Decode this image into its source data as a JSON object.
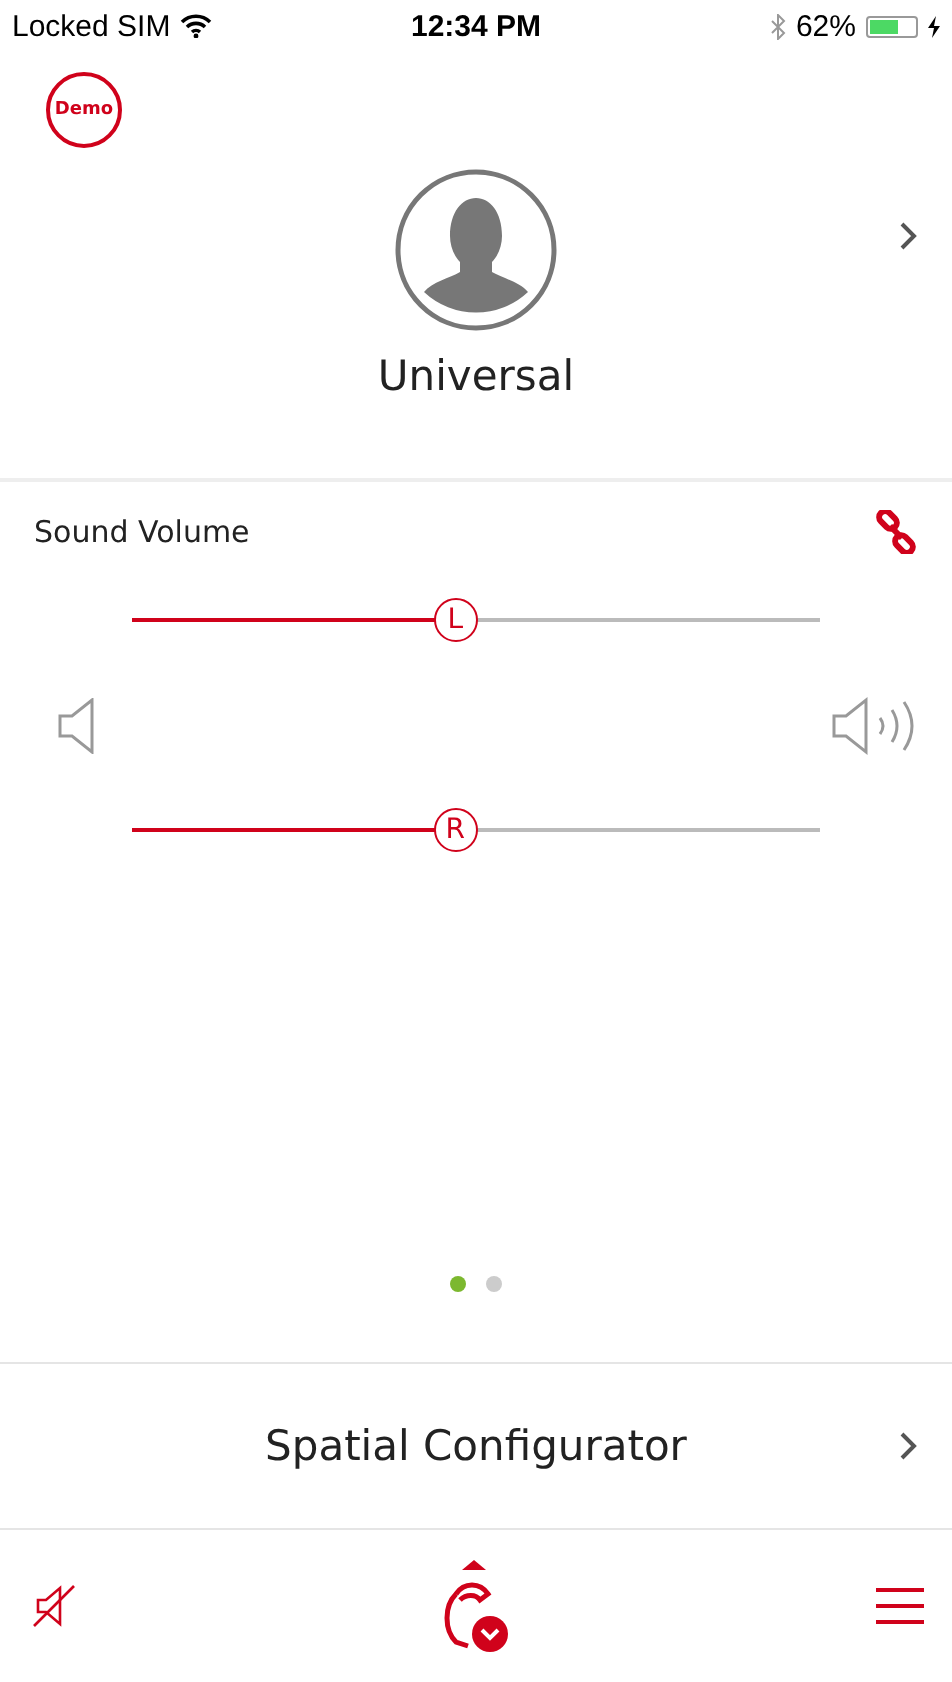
{
  "status_bar": {
    "carrier": "Locked SIM",
    "time": "12:34 PM",
    "battery": "62%"
  },
  "demo_badge": "Demo",
  "program": {
    "name": "Universal"
  },
  "volume": {
    "title": "Sound Volume",
    "linked": true,
    "sliders": [
      {
        "label": "L",
        "level": 0.47
      },
      {
        "label": "R",
        "level": 0.47
      }
    ]
  },
  "pages": [
    {
      "selected": true
    },
    {
      "selected": false
    }
  ],
  "spatial": {
    "label": "Spatial Configurator"
  }
}
